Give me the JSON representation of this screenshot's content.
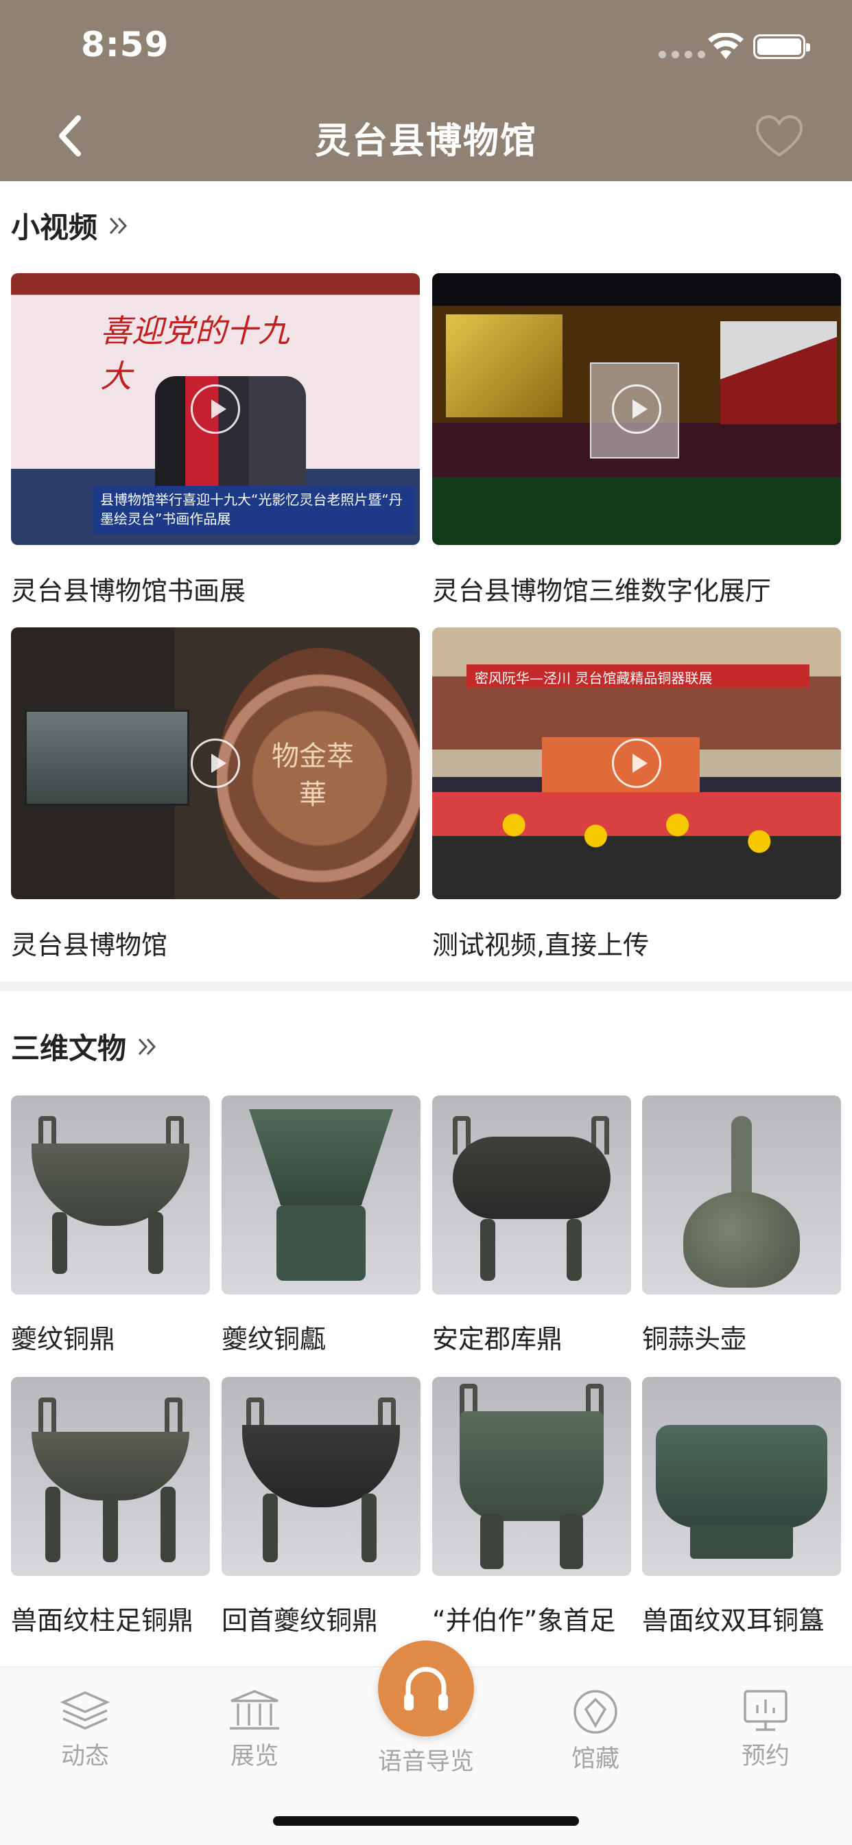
{
  "status_bar": {
    "time": "8:59"
  },
  "nav": {
    "title": "灵台县博物馆",
    "back_icon": "chevron-left-icon",
    "favorite_icon": "heart-outline-icon"
  },
  "videos_section": {
    "title": "小视频",
    "items": [
      {
        "label": "灵台县博物馆书画展",
        "thumb_banner": "喜迎党的十九大",
        "thumb_caption": "县博物馆举行喜迎十九大“光影忆灵台老照片暨“丹墨绘灵台”书画作品展"
      },
      {
        "label": "灵台县博物馆三维数字化展厅"
      },
      {
        "label": "灵台县博物馆",
        "thumb_text": "物金萃華"
      },
      {
        "label": "测试视频,直接上传",
        "thumb_sign": "密风阮华—泾川 灵台馆藏精品铜器联展"
      }
    ]
  },
  "artifacts_section": {
    "title": "三维文物",
    "items": [
      {
        "label": "夔纹铜鼎"
      },
      {
        "label": "夔纹铜甗"
      },
      {
        "label": "安定郡库鼎"
      },
      {
        "label": "铜蒜头壶"
      },
      {
        "label": "兽面纹柱足铜鼎"
      },
      {
        "label": "回首夔纹铜鼎"
      },
      {
        "label": "“并伯作”象首足"
      },
      {
        "label": "兽面纹双耳铜簋"
      }
    ]
  },
  "tabbar": {
    "tabs": [
      {
        "label": "动态",
        "icon": "layers-icon"
      },
      {
        "label": "展览",
        "icon": "museum-icon"
      },
      {
        "label": "语音导览",
        "icon": "headphones-icon"
      },
      {
        "label": "馆藏",
        "icon": "collection-icon"
      },
      {
        "label": "预约",
        "icon": "reservation-icon"
      }
    ]
  },
  "colors": {
    "header_bg": "#8f8274",
    "accent": "#e08a47",
    "tab_inactive": "#a5a5a5"
  }
}
